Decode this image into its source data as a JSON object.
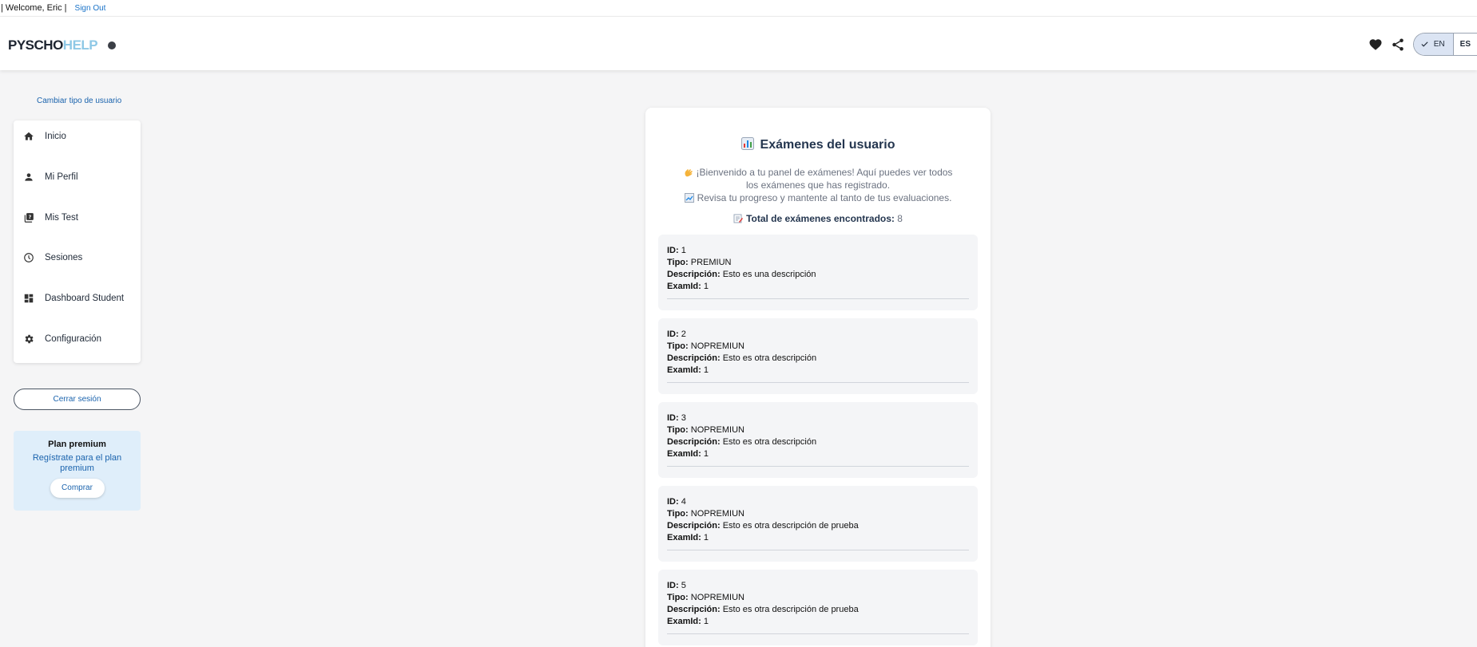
{
  "topbar": {
    "welcome": "| Welcome, Eric |",
    "signout": "Sign Out"
  },
  "header": {
    "logo_part1": "PYSCHO",
    "logo_part2": "HELP",
    "lang_en": "EN",
    "lang_es": "ES"
  },
  "sidebar": {
    "change_user_type": "Cambiar tipo de usuario",
    "items": [
      {
        "label": "Inicio",
        "icon": "home-icon"
      },
      {
        "label": "Mi Perfil",
        "icon": "person-icon"
      },
      {
        "label": "Mis Test",
        "icon": "quiz-icon"
      },
      {
        "label": "Sesiones",
        "icon": "clock-icon"
      },
      {
        "label": "Dashboard Student",
        "icon": "dashboard-icon"
      },
      {
        "label": "Configuración",
        "icon": "gear-icon"
      }
    ],
    "logout": "Cerrar sesión",
    "premium": {
      "title": "Plan premium",
      "desc": "Regístrate para el plan premium",
      "button": "Comprar"
    }
  },
  "main": {
    "title": "Exámenes del usuario",
    "intro_line1": "¡Bienvenido a tu panel de exámenes! Aquí puedes ver todos los exámenes que has registrado.",
    "intro_line2": "Revisa tu progreso y mantente al tanto de tus evaluaciones.",
    "total_label": "Total de exámenes encontrados:",
    "total_value": "8",
    "labels": {
      "id": "ID:",
      "tipo": "Tipo:",
      "descripcion": "Descripción:",
      "examid": "ExamId:"
    },
    "exams": [
      {
        "id": "1",
        "tipo": "PREMIUN",
        "descripcion": "Esto es una descripción",
        "examid": "1"
      },
      {
        "id": "2",
        "tipo": "NOPREMIUN",
        "descripcion": "Esto es otra descripción",
        "examid": "1"
      },
      {
        "id": "3",
        "tipo": "NOPREMIUN",
        "descripcion": "Esto es otra descripción",
        "examid": "1"
      },
      {
        "id": "4",
        "tipo": "NOPREMIUN",
        "descripcion": "Esto es otra descripción de prueba",
        "examid": "1"
      },
      {
        "id": "5",
        "tipo": "NOPREMIUN",
        "descripcion": "Esto es otra descripción de prueba",
        "examid": "1"
      }
    ]
  },
  "colors": {
    "accent": "#1a63ad",
    "logo_light": "#8ec8e6",
    "premium_bg": "#dfeefa"
  }
}
